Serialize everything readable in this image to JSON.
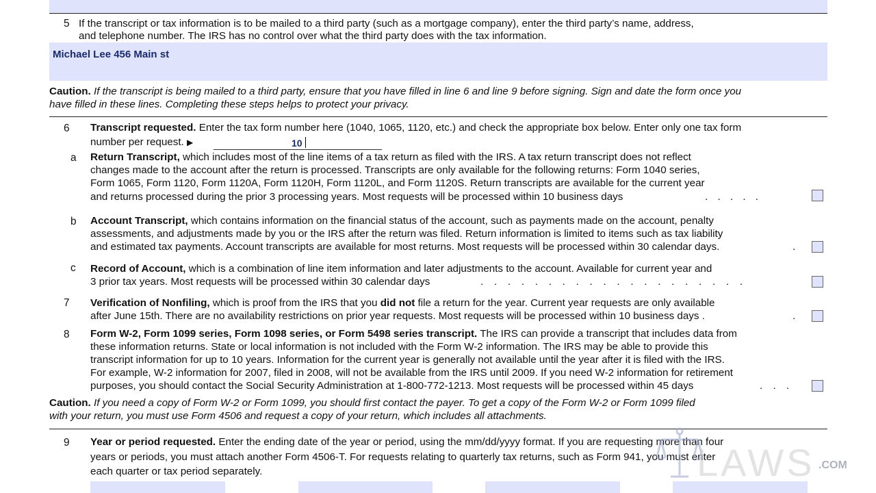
{
  "line5": {
    "num": "5",
    "text1": "If the transcript or tax information is to be mailed to a third party (such as a mortgage company), enter the third party’s name, address,",
    "text2": "and telephone number. The IRS has no control over what the third party does with the tax information.",
    "field_value": "Michael Lee 456 Main st"
  },
  "caution1": {
    "label": "Caution.",
    "text": "If the transcript is being mailed to a third party, ensure that you have filled in line 6 and line 9 before signing. Sign and date the form once you",
    "text2": "have filled in these lines. Completing these steps helps to protect your privacy."
  },
  "line6": {
    "num": "6",
    "title": "Transcript requested.",
    "text1": "Enter the tax form number here (1040, 1065, 1120, etc.) and check the appropriate box below. Enter only one tax form",
    "text2": "number per request.",
    "arrow": "▶",
    "form_number_value": "10",
    "a": {
      "letter": "a",
      "title": "Return Transcript,",
      "l1": "which includes most of the line items of a tax return as filed with the IRS. A tax return transcript does not reflect",
      "l2": "changes made to the account after the return is processed. Transcripts are only available for the following returns: Form 1040 series,",
      "l3": "Form 1065, Form 1120, Form 1120A, Form 1120H, Form 1120L, and Form 1120S. Return transcripts are available for the current year",
      "l4": "and returns processed during the prior 3 processing years. Most requests  will be processed within 10 business days",
      "dots": ". . . . ."
    },
    "b": {
      "letter": "b",
      "title": "Account Transcript,",
      "l1": "which contains information on the financial status of the account, such as payments made on the account, penalty",
      "l2": "assessments, and adjustments made by you or the IRS after the return was filed. Return information is limited to items such as tax liability",
      "l3": "and estimated tax payments. Account transcripts are available for most returns. Most requests will be processed within 30 calendar days.",
      "dots": "."
    },
    "c": {
      "letter": "c",
      "title": "Record of Account,",
      "l1": "which is a combination of line item information and later adjustments to the account. Available for current year and",
      "l2": "3 prior tax years. Most requests will be processed within 30 calendar days",
      "dots": ". . . . . . . . . . . . . . . . . . . ."
    }
  },
  "line7": {
    "num": "7",
    "title": "Verification of Nonfiling,",
    "l1a": "which is proof from the IRS that you",
    "l1b": "did not",
    "l1c": "file a return for the year. Current year requests are only available",
    "l2": "after June 15th. There are no availability restrictions on prior year requests. Most requests will be processed within 10 business days .",
    "dots": "."
  },
  "line8": {
    "num": "8",
    "title": "Form W-2, Form 1099 series, Form 1098 series, or Form 5498 series transcript.",
    "l1": "The IRS can provide a transcript that includes data from",
    "l2": "these information returns. State or local information is not included with the Form W-2 information. The IRS may be able to provide this",
    "l3": "transcript information for up to 10 years. Information for the current year is generally not available until the year after it is filed with the IRS.",
    "l4": "For example, W-2 information for 2007, filed in 2008, will not be available from the IRS until 2009. If you need W-2 information for retirement",
    "l5": "purposes, you should contact the Social Security Administration at 1-800-772-1213. Most requests will be processed within 45 days",
    "dots": ". . ."
  },
  "caution2": {
    "label": "Caution.",
    "text": "If you need a copy of Form W-2 or Form 1099, you should first contact the payer. To get a copy of the Form W-2 or Form 1099 filed",
    "text2": "with your return, you must use Form 4506 and request a copy of your return, which includes all attachments."
  },
  "line9": {
    "num": "9",
    "title": "Year or period requested.",
    "l1": "Enter the ending date of the year or period, using the mm/dd/yyyy format. If you are requesting more than four",
    "l2": "years or periods, you must attach another Form 4506-T. For requests relating to quarterly tax returns, such as Form 941, you must enter",
    "l3": "each quarter or tax period separately."
  },
  "watermark": {
    "brand": "LAWS",
    "suffix": ".COM",
    "icon": "scales-of-justice-icon"
  }
}
